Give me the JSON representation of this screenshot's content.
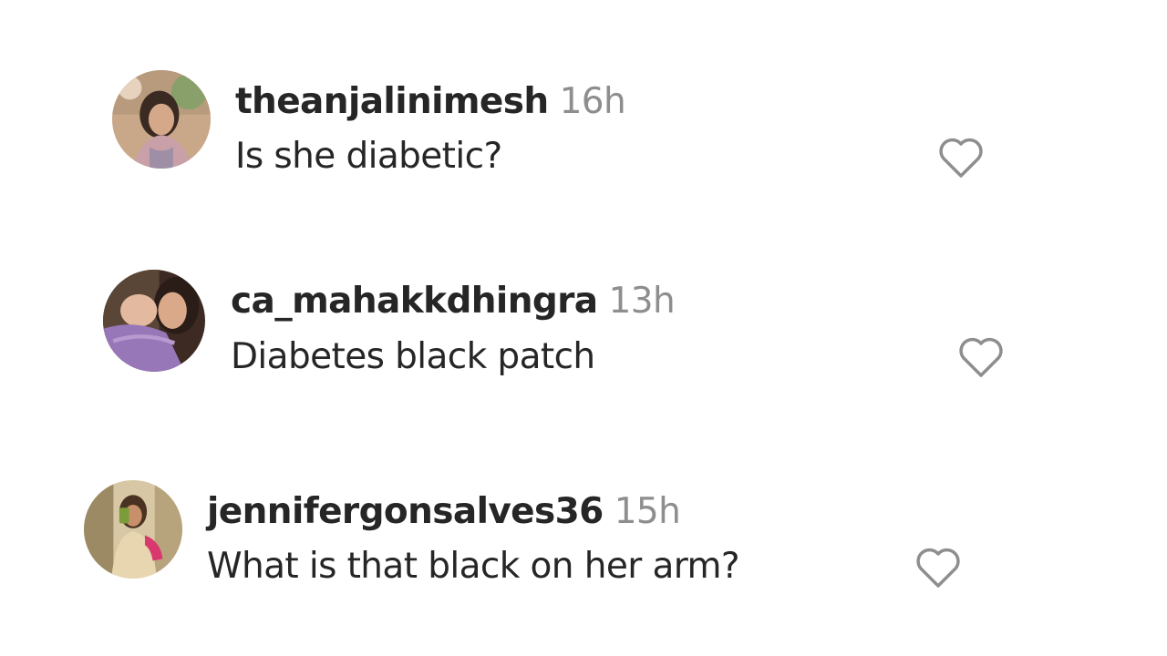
{
  "comments": [
    {
      "username": "theanjalinimesh",
      "time": "16h",
      "text": "Is she diabetic?",
      "avatar_icon": "profile-photo",
      "like_icon": "heart-outline-icon"
    },
    {
      "username": "ca_mahakkdhingra",
      "time": "13h",
      "text": "Diabetes black patch",
      "avatar_icon": "profile-photo",
      "like_icon": "heart-outline-icon"
    },
    {
      "username": "jennifergonsalves36",
      "time": "15h",
      "text": "What is that black on her arm?",
      "avatar_icon": "profile-photo",
      "like_icon": "heart-outline-icon"
    }
  ],
  "colors": {
    "text": "#262626",
    "secondary_text": "#8e8e8e",
    "heart_stroke": "#8e8e8e",
    "background": "#ffffff"
  }
}
